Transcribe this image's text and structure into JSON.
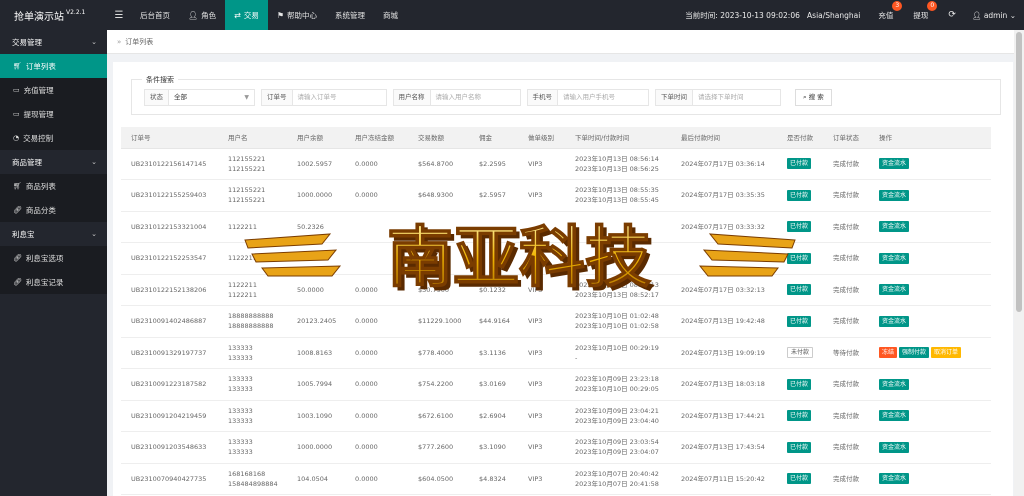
{
  "brand": {
    "name": "抢单演示站",
    "version": "V2.2.1"
  },
  "nav": [
    {
      "label": "后台首页",
      "icon": ""
    },
    {
      "label": "角色",
      "icon": "user-icon"
    },
    {
      "label": "交易",
      "icon": "exchange-icon"
    },
    {
      "label": "帮助中心",
      "icon": "flag-icon"
    },
    {
      "label": "系统管理",
      "icon": ""
    },
    {
      "label": "商城",
      "icon": ""
    }
  ],
  "top": {
    "time_label": "当前时间: 2023-10-13 09:02:06",
    "timezone": "Asia/Shanghai",
    "recharge": "充值",
    "recharge_badge": "3",
    "withdraw": "提现",
    "withdraw_badge": "0",
    "user": "admin"
  },
  "sidebar": [
    {
      "type": "group",
      "label": "交易管理"
    },
    {
      "type": "item",
      "label": "订单列表",
      "icon": "cart-icon",
      "active": true
    },
    {
      "type": "item",
      "label": "充值管理",
      "icon": "card-icon"
    },
    {
      "type": "item",
      "label": "提现管理",
      "icon": "card-icon"
    },
    {
      "type": "item",
      "label": "交易控制",
      "icon": "dashboard-icon"
    },
    {
      "type": "group",
      "label": "商品管理"
    },
    {
      "type": "item",
      "label": "商品列表",
      "icon": "cart-icon"
    },
    {
      "type": "item",
      "label": "商品分类",
      "icon": "link-icon"
    },
    {
      "type": "group",
      "label": "利息宝"
    },
    {
      "type": "item",
      "label": "利息宝选项",
      "icon": "link-icon"
    },
    {
      "type": "item",
      "label": "利息宝记录",
      "icon": "link-icon"
    }
  ],
  "breadcrumb": "订单列表",
  "search": {
    "legend": "条件搜索",
    "status_label": "状态",
    "status_value": "全部",
    "order_label": "订单号",
    "order_placeholder": "请输入订单号",
    "username_label": "用户名称",
    "username_placeholder": "请输入用户名称",
    "phone_label": "手机号",
    "phone_placeholder": "请输入用户手机号",
    "time_label": "下单时间",
    "time_placeholder": "请选择下单时间",
    "button": "搜 索"
  },
  "table": {
    "headers": [
      "订单号",
      "用户名",
      "用户余额",
      "用户冻结金额",
      "交易数额",
      "佣金",
      "做单级别",
      "下单时间/付款时间",
      "最后付款时间",
      "是否付款",
      "订单状态",
      "操作"
    ],
    "rows": [
      {
        "order": "UB2310122156147145",
        "user1": "112155221",
        "user2": "112155221",
        "balance": "1002.5957",
        "frozen": "0.0000",
        "amount": "$564.8700",
        "comm": "$2.2595",
        "level": "VIP3",
        "t1": "2023年10月13日 08:56:14",
        "t2": "2023年10月13日 08:56:25",
        "last": "2024年07月17日 03:36:14",
        "pay": "已付款",
        "pay_style": "green",
        "state": "完成付款",
        "ops": [
          {
            "label": "资金流水",
            "style": "green"
          }
        ]
      },
      {
        "order": "UB2310122155259403",
        "user1": "112155221",
        "user2": "112155221",
        "balance": "1000.0000",
        "frozen": "0.0000",
        "amount": "$648.9300",
        "comm": "$2.5957",
        "level": "VIP3",
        "t1": "2023年10月13日 08:55:35",
        "t2": "2023年10月13日 08:55:45",
        "last": "2024年07月17日 03:35:35",
        "pay": "已付款",
        "pay_style": "green",
        "state": "完成付款",
        "ops": [
          {
            "label": "资金流水",
            "style": "green"
          }
        ]
      },
      {
        "order": "UB2310122153321004",
        "user1": "1122211",
        "user2": "",
        "balance": "50.2326",
        "frozen": "",
        "amount": "",
        "comm": "",
        "level": "",
        "t1": "",
        "t2": "",
        "last": "2024年07月17日 03:33:32",
        "pay": "已付款",
        "pay_style": "green",
        "state": "完成付款",
        "ops": [
          {
            "label": "资金流水",
            "style": "green"
          }
        ]
      },
      {
        "order": "UB2310122152253547",
        "user1": "1122211",
        "user2": "",
        "balance": "",
        "frozen": "",
        "amount": "",
        "comm": "",
        "level": "",
        "t1": "",
        "t2": "",
        "last": "",
        "pay": "已付款",
        "pay_style": "green",
        "state": "完成付款",
        "ops": [
          {
            "label": "资金流水",
            "style": "green"
          }
        ]
      },
      {
        "order": "UB2310122152138206",
        "user1": "1122211",
        "user2": "1122211",
        "balance": "50.0000",
        "frozen": "0.0000",
        "amount": "$30.7900",
        "comm": "$0.1232",
        "level": "VIP3",
        "t1": "2023年10月13日 08:52:13",
        "t2": "2023年10月13日 08:52:17",
        "last": "2024年07月17日 03:32:13",
        "pay": "已付款",
        "pay_style": "green",
        "state": "完成付款",
        "ops": [
          {
            "label": "资金流水",
            "style": "green"
          }
        ]
      },
      {
        "order": "UB2310091402486887",
        "user1": "18888888888",
        "user2": "18888888888",
        "balance": "20123.2405",
        "frozen": "0.0000",
        "amount": "$11229.1000",
        "comm": "$44.9164",
        "level": "VIP3",
        "t1": "2023年10月10日 01:02:48",
        "t2": "2023年10月10日 01:02:58",
        "last": "2024年07月13日 19:42:48",
        "pay": "已付款",
        "pay_style": "green",
        "state": "完成付款",
        "ops": [
          {
            "label": "资金流水",
            "style": "green"
          }
        ]
      },
      {
        "order": "UB2310091329197737",
        "user1": "133333",
        "user2": "133333",
        "balance": "1008.8163",
        "frozen": "0.0000",
        "amount": "$778.4000",
        "comm": "$3.1136",
        "level": "VIP3",
        "t1": "2023年10月10日 00:29:19",
        "t2": "-",
        "last": "2024年07月13日 19:09:19",
        "pay": "未付款",
        "pay_style": "outline",
        "state": "等待付款",
        "ops": [
          {
            "label": "冻结",
            "style": "red"
          },
          {
            "label": "强制付款",
            "style": "green"
          },
          {
            "label": "取消订单",
            "style": "orange"
          }
        ]
      },
      {
        "order": "UB2310091223187582",
        "user1": "133333",
        "user2": "133333",
        "balance": "1005.7994",
        "frozen": "0.0000",
        "amount": "$754.2200",
        "comm": "$3.0169",
        "level": "VIP3",
        "t1": "2023年10月09日 23:23:18",
        "t2": "2023年10月10日 00:29:05",
        "last": "2024年07月13日 18:03:18",
        "pay": "已付款",
        "pay_style": "green",
        "state": "完成付款",
        "ops": [
          {
            "label": "资金流水",
            "style": "green"
          }
        ]
      },
      {
        "order": "UB2310091204219459",
        "user1": "133333",
        "user2": "133333",
        "balance": "1003.1090",
        "frozen": "0.0000",
        "amount": "$672.6100",
        "comm": "$2.6904",
        "level": "VIP3",
        "t1": "2023年10月09日 23:04:21",
        "t2": "2023年10月09日 23:04:40",
        "last": "2024年07月13日 17:44:21",
        "pay": "已付款",
        "pay_style": "green",
        "state": "完成付款",
        "ops": [
          {
            "label": "资金流水",
            "style": "green"
          }
        ]
      },
      {
        "order": "UB2310091203548633",
        "user1": "133333",
        "user2": "133333",
        "balance": "1000.0000",
        "frozen": "0.0000",
        "amount": "$777.2600",
        "comm": "$3.1090",
        "level": "VIP3",
        "t1": "2023年10月09日 23:03:54",
        "t2": "2023年10月09日 23:04:07",
        "last": "2024年07月13日 17:43:54",
        "pay": "已付款",
        "pay_style": "green",
        "state": "完成付款",
        "ops": [
          {
            "label": "资金流水",
            "style": "green"
          }
        ]
      },
      {
        "order": "UB2310070940427735",
        "user1": "168168168",
        "user2": "158484898884",
        "balance": "104.0504",
        "frozen": "0.0000",
        "amount": "$604.0500",
        "comm": "$4.8324",
        "level": "VIP3",
        "t1": "2023年10月07日 20:40:42",
        "t2": "2023年10月07日 20:41:58",
        "last": "2024年07月11日 15:20:42",
        "pay": "已付款",
        "pay_style": "green",
        "state": "完成付款",
        "ops": [
          {
            "label": "资金流水",
            "style": "green"
          }
        ]
      }
    ]
  },
  "watermark": "南亚科技",
  "colors": {
    "accent": "#009688",
    "dark": "#23262e",
    "danger": "#ff5722",
    "warn": "#ffb800"
  }
}
